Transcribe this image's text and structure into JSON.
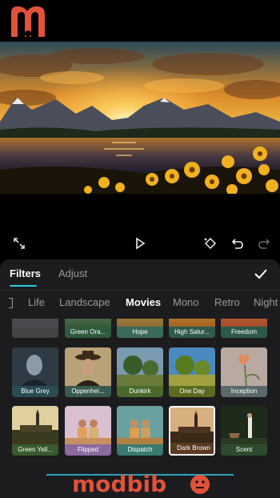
{
  "brand": {
    "logo_letter": "m",
    "watermark": "modbibo",
    "accent": "#e0523a"
  },
  "tabs": [
    {
      "label": "Filters",
      "active": true
    },
    {
      "label": "Adjust",
      "active": false
    }
  ],
  "categories": [
    {
      "label": "Life",
      "active": false
    },
    {
      "label": "Landscape",
      "active": false
    },
    {
      "label": "Movies",
      "active": true
    },
    {
      "label": "Mono",
      "active": false
    },
    {
      "label": "Retro",
      "active": false
    },
    {
      "label": "Night",
      "active": false
    }
  ],
  "filters": {
    "row_partial": [
      "Green Ora...",
      "Hope",
      "High Satur...",
      "Freedom"
    ],
    "row_1": [
      "Blue Grey",
      "Oppenhei...",
      "Dunkirk",
      "One Day",
      "Inception"
    ],
    "row_2": [
      "Green Yell...",
      "Flipped",
      "Dispatch",
      "Dark Brown",
      "Scent"
    ],
    "selected": "Dark Brown"
  },
  "colors": {
    "panel_bg": "#1c1c1e",
    "accent_blue": "#2ec6e6"
  },
  "icons": [
    "fullscreen-icon",
    "play-icon",
    "keyframe-icon",
    "undo-icon",
    "redo-icon",
    "checkmark-icon"
  ]
}
